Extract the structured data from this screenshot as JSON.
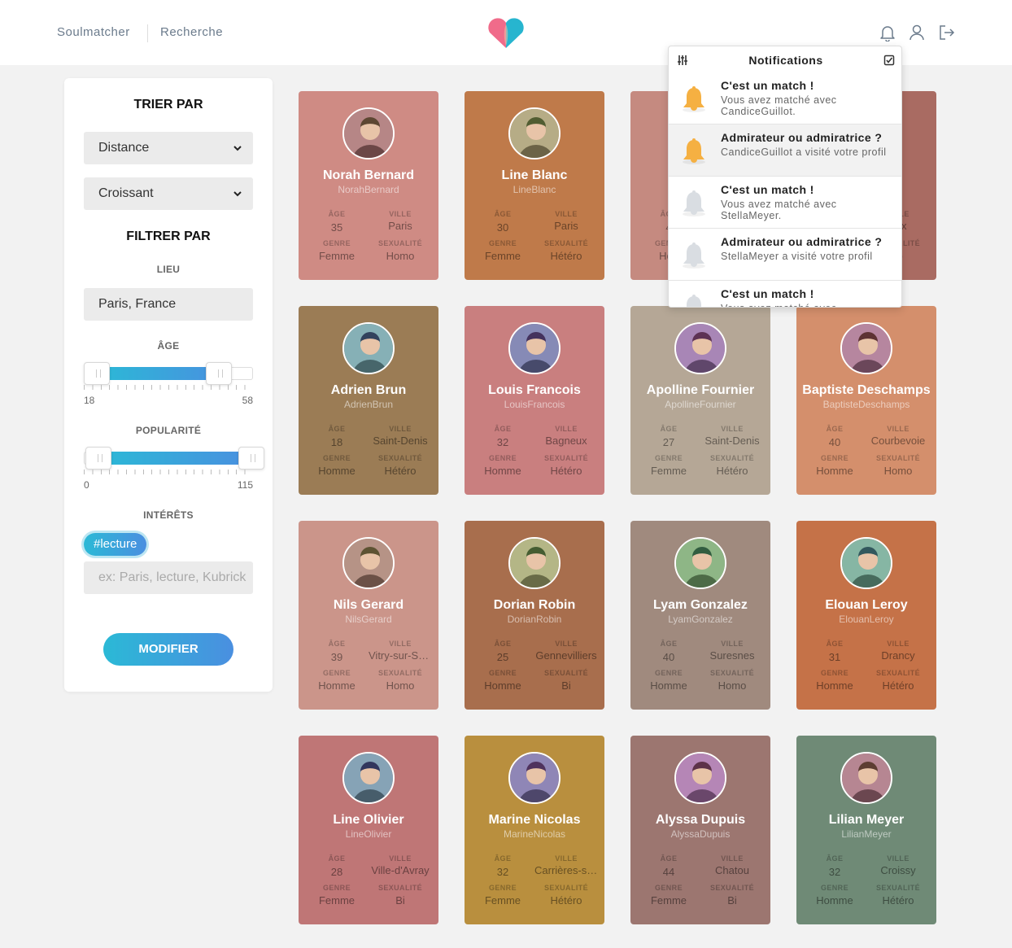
{
  "nav": {
    "brand_label": "Soulmatcher",
    "search_label": "Recherche"
  },
  "sidebar": {
    "sort_title": "TRIER PAR",
    "sort_by": "Distance",
    "sort_order": "Croissant",
    "filter_title": "FILTRER PAR",
    "location_label": "LIEU",
    "location_value": "Paris, France",
    "age_label": "ÂGE",
    "age_min": "18",
    "age_max": "58",
    "age_range_fraction": [
      0.0,
      0.8
    ],
    "popularity_label": "POPULARITÉ",
    "popularity_min": "0",
    "popularity_max": "115",
    "popularity_range_fraction": [
      0.0,
      1.0
    ],
    "interests_label": "INTÉRÊTS",
    "interest_tags": [
      "#lecture"
    ],
    "interests_placeholder": "ex: Paris, lecture, Kubrick",
    "modify_button": "MODIFIER"
  },
  "card_labels": {
    "age": "ÂGE",
    "city": "VILLE",
    "gender": "GENRE",
    "sexuality": "SEXUALITÉ"
  },
  "profiles": [
    {
      "name": "Norah Bernard",
      "login": "NorahBernard",
      "age": "35",
      "city": "Paris",
      "gender": "Femme",
      "sexuality": "Homo",
      "color": "#cf8b84"
    },
    {
      "name": "Line Blanc",
      "login": "LineBlanc",
      "age": "30",
      "city": "Paris",
      "gender": "Femme",
      "sexuality": "Hétéro",
      "color": "#bf7a4a"
    },
    {
      "name": "",
      "login": "",
      "age": "4",
      "city": "",
      "gender": "Hon",
      "sexuality": "",
      "color": "#c58a80"
    },
    {
      "name": "",
      "login": "",
      "age": "",
      "city": "eux",
      "gender": "",
      "sexuality": "ro",
      "color": "#a96b62"
    },
    {
      "name": "Adrien Brun",
      "login": "AdrienBrun",
      "age": "18",
      "city": "Saint-Denis",
      "gender": "Homme",
      "sexuality": "Hétéro",
      "color": "#9b7c55"
    },
    {
      "name": "Louis Francois",
      "login": "LouisFrancois",
      "age": "32",
      "city": "Bagneux",
      "gender": "Homme",
      "sexuality": "Hétéro",
      "color": "#c97f7f"
    },
    {
      "name": "Apolline Fournier",
      "login": "ApollineFournier",
      "age": "27",
      "city": "Saint-Denis",
      "gender": "Femme",
      "sexuality": "Hétéro",
      "color": "#b5a796"
    },
    {
      "name": "Baptiste Deschamps",
      "login": "BaptisteDeschamps",
      "age": "40",
      "city": "Courbevoie",
      "gender": "Homme",
      "sexuality": "Homo",
      "color": "#d48f6c"
    },
    {
      "name": "Nils Gerard",
      "login": "NilsGerard",
      "age": "39",
      "city": "Vitry-sur-Seine",
      "gender": "Homme",
      "sexuality": "Homo",
      "color": "#cb958a"
    },
    {
      "name": "Dorian Robin",
      "login": "DorianRobin",
      "age": "25",
      "city": "Gennevilliers",
      "gender": "Homme",
      "sexuality": "Bi",
      "color": "#a86e4d"
    },
    {
      "name": "Lyam Gonzalez",
      "login": "LyamGonzalez",
      "age": "40",
      "city": "Suresnes",
      "gender": "Homme",
      "sexuality": "Homo",
      "color": "#a08a7e"
    },
    {
      "name": "Elouan Leroy",
      "login": "ElouanLeroy",
      "age": "31",
      "city": "Drancy",
      "gender": "Homme",
      "sexuality": "Hétéro",
      "color": "#c57248"
    },
    {
      "name": "Line Olivier",
      "login": "LineOlivier",
      "age": "28",
      "city": "Ville-d'Avray",
      "gender": "Femme",
      "sexuality": "Bi",
      "color": "#bf7676"
    },
    {
      "name": "Marine Nicolas",
      "login": "MarineNicolas",
      "age": "32",
      "city": "Carrières-sur-Seine",
      "gender": "Femme",
      "sexuality": "Hétéro",
      "color": "#b98f3e"
    },
    {
      "name": "Alyssa Dupuis",
      "login": "AlyssaDupuis",
      "age": "44",
      "city": "Chatou",
      "gender": "Femme",
      "sexuality": "Bi",
      "color": "#9c7670"
    },
    {
      "name": "Lilian Meyer",
      "login": "LilianMeyer",
      "age": "32",
      "city": "Croissy",
      "gender": "Homme",
      "sexuality": "Hétéro",
      "color": "#6f8a76"
    }
  ],
  "notifications": {
    "title": "Notifications",
    "items": [
      {
        "title": "C'est un match !",
        "body": "Vous avez matché avec CandiceGuillot.",
        "seen": true
      },
      {
        "title": "Admirateur ou admiratrice ?",
        "body": "CandiceGuillot a visité votre profil",
        "seen": false
      },
      {
        "title": "C'est un match !",
        "body": "Vous avez matché avec StellaMeyer.",
        "seen": true
      },
      {
        "title": "Admirateur ou admiratrice ?",
        "body": "StellaMeyer a visité votre profil",
        "seen": true
      },
      {
        "title": "C'est un match !",
        "body": "Vous avez matché avec",
        "seen": true
      }
    ]
  },
  "colors": {
    "accent_start": "#2bb9d6",
    "accent_end": "#4a8fe0",
    "bell_active": "#f5b042",
    "bell_inactive": "#d9dde2",
    "logo_pink": "#f06b8a",
    "logo_teal": "#27b5cf"
  }
}
